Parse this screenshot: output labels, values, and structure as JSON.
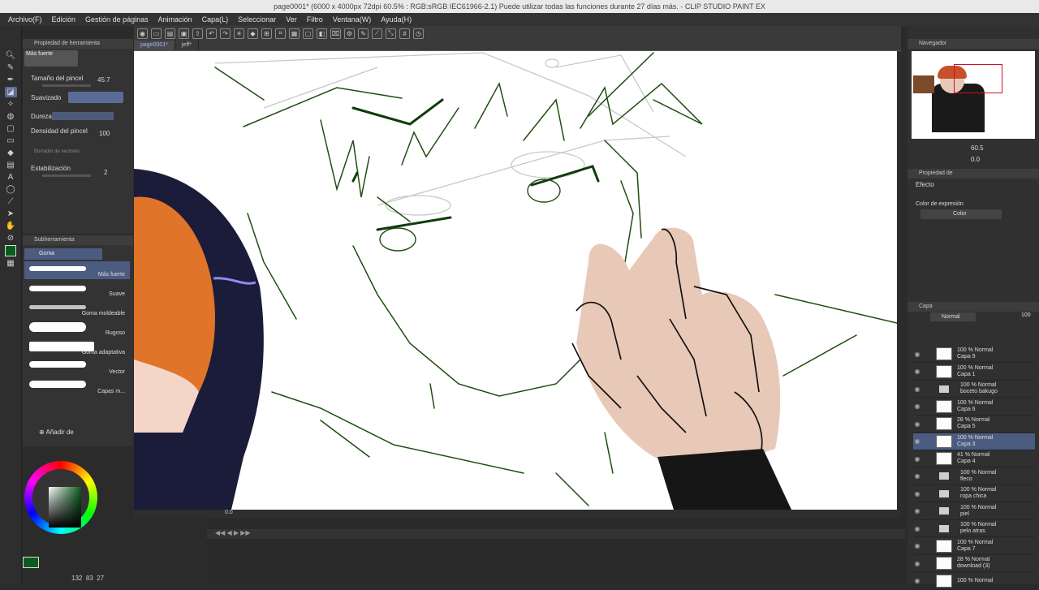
{
  "window": {
    "title": "page0001* (6000 x 4000px 72dpi 60.5% : RGB:sRGB IEC61966-2.1)  Puede utilizar todas las funciones durante 27 días más. - CLIP STUDIO PAINT EX"
  },
  "menu": [
    "Archivo(F)",
    "Edición",
    "Gestión de páginas",
    "Animación",
    "Capa(L)",
    "Seleccionar",
    "Ver",
    "Filtro",
    "Ventana(W)",
    "Ayuda(H)"
  ],
  "tabs": [
    "page0001*",
    "jeff*"
  ],
  "tool_property": {
    "header": "Propiedad de herramienta",
    "current": "Más fuerte",
    "brush_size_label": "Tamaño del pincel",
    "brush_size_value": "45.7",
    "smoothing_label": "Suavizado",
    "hardness_label": "Dureza",
    "density_label": "Densidad del pincel",
    "density_value": "100",
    "vector_eraser_label": "Borrador de vectores",
    "stabilization_label": "Estabilización",
    "stabilization_value": "2"
  },
  "subtool": {
    "header": "Subherramienta",
    "group": "Goma",
    "items": [
      "Más fuerte",
      "Suave",
      "Goma moldeable",
      "Rugoso",
      "Goma adaptativa",
      "Vector",
      "Capas m..."
    ],
    "add_label": "Añadir de"
  },
  "navigator": {
    "header": "Navegador",
    "zoom": "60.5",
    "rotation": "0.0"
  },
  "layer_property": {
    "header": "Propiedad de",
    "effect_label": "Efecto",
    "expression_label": "Color de expresión",
    "expression_value": "Color"
  },
  "layers": {
    "header": "Capa",
    "blend": "Normal",
    "opacity": "100",
    "items": [
      {
        "pct": "100 %",
        "mode": "Normal",
        "name": "Capa 9"
      },
      {
        "pct": "100 %",
        "mode": "Normal",
        "name": "Capa 1"
      },
      {
        "pct": "100 %",
        "mode": "Normal",
        "name": "boceto bakugo",
        "folder": true
      },
      {
        "pct": "100 %",
        "mode": "Normal",
        "name": "Capa 6"
      },
      {
        "pct": "28 %",
        "mode": "Normal",
        "name": "Capa 5"
      },
      {
        "pct": "100 %",
        "mode": "Normal",
        "name": "Capa 3",
        "selected": true
      },
      {
        "pct": "41 %",
        "mode": "Normal",
        "name": "Capa 4"
      },
      {
        "pct": "100 %",
        "mode": "Normal",
        "name": "fleco",
        "folder": true
      },
      {
        "pct": "100 %",
        "mode": "Normal",
        "name": "ropa chica",
        "folder": true
      },
      {
        "pct": "100 %",
        "mode": "Normal",
        "name": "piel",
        "folder": true
      },
      {
        "pct": "100 %",
        "mode": "Normal",
        "name": "pelo atras",
        "folder": true
      },
      {
        "pct": "100 %",
        "mode": "Normal",
        "name": "Capa 7"
      },
      {
        "pct": "28 %",
        "mode": "Normal",
        "name": "download (3)"
      },
      {
        "pct": "100 %",
        "mode": "Normal",
        "name": ""
      }
    ]
  },
  "status": {
    "a": "132",
    "b": "83",
    "c": "27",
    "frame": "0.0"
  },
  "colors": {
    "main": "#0a5c1e",
    "accent": "#5a6c96",
    "sketch": "#1f4d12",
    "skin": "#e8c9b8",
    "hair_orange": "#e07428",
    "hair_dark": "#1b1b3a"
  }
}
